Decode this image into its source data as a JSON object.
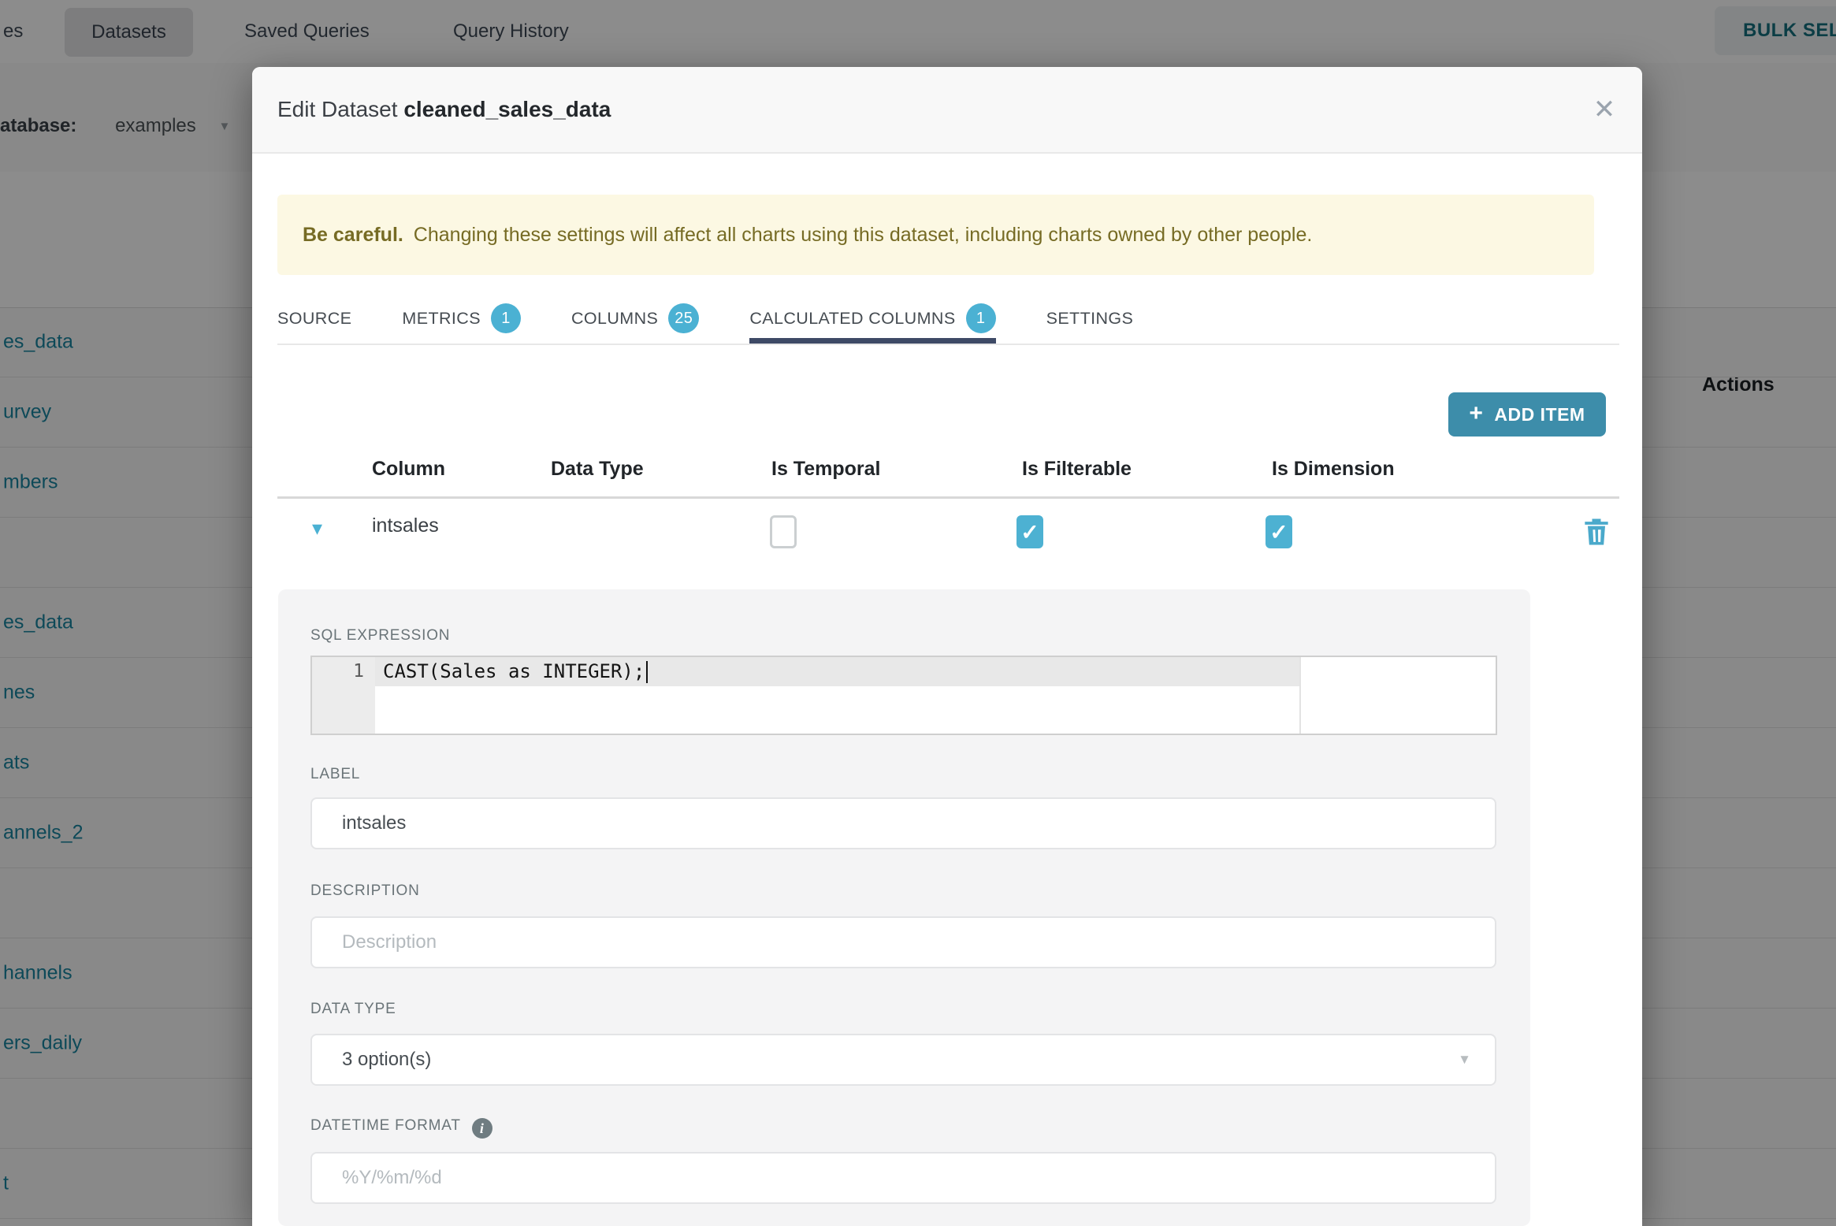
{
  "background": {
    "topnav": {
      "clipped_item": "es",
      "active_item": "Datasets",
      "saved_queries": "Saved Queries",
      "query_history": "Query History",
      "bulk_select_label": "BULK SELE"
    },
    "database_bar": {
      "label": "atabase:",
      "value": "examples",
      "caret": "▼"
    },
    "table": {
      "actions_header": "Actions",
      "dataset_links": [
        "es_data",
        "urvey",
        "mbers",
        "",
        "es_data",
        "nes",
        "ats",
        "annels_2",
        "",
        "hannels",
        "ers_daily",
        "",
        "t"
      ]
    }
  },
  "modal": {
    "title_prefix": "Edit Dataset",
    "title_dataset": "cleaned_sales_data",
    "close_icon": "✕",
    "warning": {
      "bold": "Be careful.",
      "text": "Changing these settings will affect all charts using this dataset, including charts owned by other people."
    },
    "tabs": [
      {
        "label": "SOURCE",
        "badge": null,
        "active": false
      },
      {
        "label": "METRICS",
        "badge": "1",
        "active": false
      },
      {
        "label": "COLUMNS",
        "badge": "25",
        "active": false
      },
      {
        "label": "CALCULATED COLUMNS",
        "badge": "1",
        "active": true
      },
      {
        "label": "SETTINGS",
        "badge": null,
        "active": false
      }
    ],
    "add_item": {
      "plus_icon": "+",
      "label": "ADD ITEM"
    },
    "columns_table": {
      "headers": [
        "Column",
        "Data Type",
        "Is Temporal",
        "Is Filterable",
        "Is Dimension"
      ],
      "row": {
        "expand_caret": "▾",
        "name": "intsales",
        "is_temporal": false,
        "is_filterable": true,
        "is_dimension": true,
        "check_glyph": "✓"
      }
    },
    "editor_panel": {
      "sql_label": "SQL EXPRESSION",
      "sql_line_number": "1",
      "sql_code": "CAST(Sales as INTEGER);",
      "label_label": "LABEL",
      "label_value": "intsales",
      "description_label": "DESCRIPTION",
      "description_placeholder": "Description",
      "datatype_label": "DATA TYPE",
      "datatype_value": "3 option(s)",
      "datatype_caret": "▼",
      "datetime_label": "DATETIME FORMAT",
      "datetime_info_icon": "i",
      "datetime_placeholder": "%Y/%m/%d"
    }
  },
  "colors": {
    "accent_teal": "#4bb1d3",
    "button_teal": "#3d8daa",
    "link_teal": "#1985a0",
    "tab_underline_navy": "#3e4a66",
    "warning_bg": "#fcf8e3",
    "warning_text": "#766b24",
    "overlay": "rgba(0,0,0,0.45)"
  }
}
